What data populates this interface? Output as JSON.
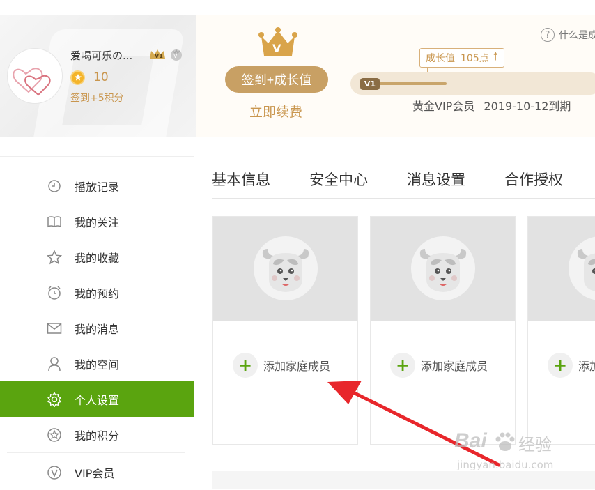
{
  "user": {
    "name": "爱喝可乐の...",
    "coins": "10",
    "sign_points": "签到+5积分"
  },
  "vip": {
    "signin_label": "签到+成长值",
    "renew_label": "立即续费",
    "help_text": "什么是成",
    "growth_label": "成长值",
    "growth_points": "105点",
    "level": "V1",
    "membership": "黄金VIP会员",
    "expiry": "2019-10-12到期",
    "progress": 0.3
  },
  "sidebar": {
    "items": [
      {
        "label": "播放记录",
        "icon": "clock-icon"
      },
      {
        "label": "我的关注",
        "icon": "book-icon"
      },
      {
        "label": "我的收藏",
        "icon": "star-icon"
      },
      {
        "label": "我的预约",
        "icon": "alarm-icon"
      },
      {
        "label": "我的消息",
        "icon": "mail-icon"
      },
      {
        "label": "我的空间",
        "icon": "user-icon"
      },
      {
        "label": "个人设置",
        "icon": "gear-icon",
        "active": true
      },
      {
        "label": "我的积分",
        "icon": "points-icon"
      },
      {
        "label": "VIP会员",
        "icon": "vip-icon"
      }
    ]
  },
  "tabs": [
    {
      "label": "基本信息"
    },
    {
      "label": "安全中心"
    },
    {
      "label": "消息设置"
    },
    {
      "label": "合作授权"
    }
  ],
  "family": {
    "add_label": "添加家庭成员",
    "add_label_cut": "添加"
  },
  "watermark": {
    "brand": "Bai",
    "brand_suffix": "经验",
    "url": "jingyan.baidu.com"
  },
  "colors": {
    "accent_green": "#5aa40f",
    "gold": "#c8a064",
    "annotation_arrow": "#e8262b"
  }
}
